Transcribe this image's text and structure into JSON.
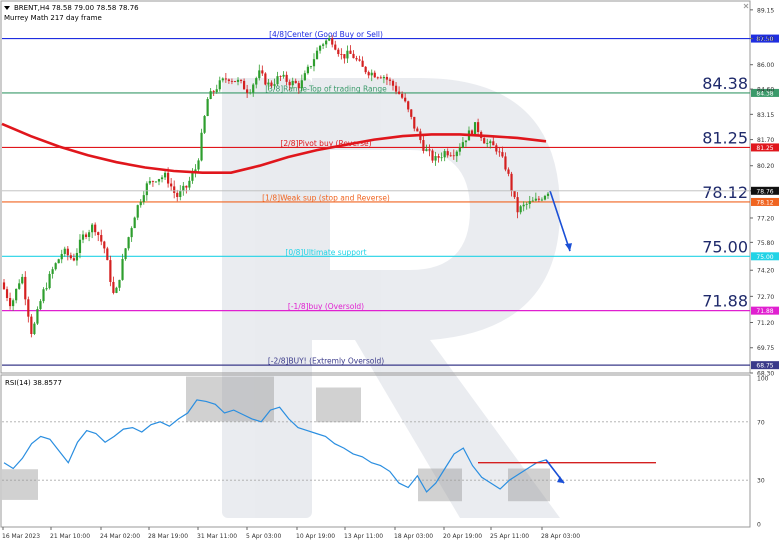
{
  "header": {
    "symbol_line": "BRENT,H4  78.58 79.00 78.58 78.76",
    "indicator_line": "Murrey Math 217 day frame"
  },
  "colors": {
    "bull": "#2e9e2e",
    "bear": "#d42020",
    "ma": "#e0161c",
    "rsi": "#2a8ee0",
    "arrow": "#1a4fd6",
    "level_4_8": "#1f2ee0",
    "level_3_8": "#3a9a6a",
    "level_2_8": "#e0161c",
    "level_1_8": "#f06420",
    "level_0_8": "#22d3e6",
    "level_m1_8": "#e020d0",
    "level_m2_8": "#3a3a8a"
  },
  "chart_data": [
    {
      "type": "line",
      "title": "BRENT,H4",
      "ylim": [
        68.3,
        89.6
      ],
      "y_ticks": [
        "89.15",
        "87.50",
        "86.00",
        "84.60",
        "83.15",
        "81.70",
        "80.20",
        "78.76",
        "77.20",
        "75.80",
        "74.20",
        "72.70",
        "71.20",
        "69.75",
        "68.30"
      ],
      "x_ticks": [
        "16 Mar 2023",
        "21 Mar 10:00",
        "24 Mar 02:00",
        "28 Mar 19:00",
        "31 Mar 11:00",
        "5 Apr 03:00",
        "10 Apr 19:00",
        "13 Apr 11:00",
        "18 Apr 03:00",
        "20 Apr 19:00",
        "25 Apr 11:00",
        "28 Apr 03:00"
      ],
      "levels": [
        {
          "key": "level_4_8",
          "value": 87.5,
          "label": "[4/8]Center (Good Buy or Sell)",
          "price_tag": "87.50",
          "big_value": ""
        },
        {
          "key": "level_3_8",
          "value": 84.38,
          "label": "[3/8]Range-Top of trading Range",
          "price_tag": "84.38",
          "big_value": "84.38"
        },
        {
          "key": "level_2_8",
          "value": 81.25,
          "label": "[2/8]Pivot buy (Reverse)",
          "price_tag": "81.25",
          "big_value": "81.25"
        },
        {
          "key": "level_1_8",
          "value": 78.12,
          "label": "[1/8]Weak sup (stop and Reverse)",
          "price_tag": "78.12",
          "big_value": "78.12"
        },
        {
          "key": "level_0_8",
          "value": 75.0,
          "label": "[0/8]Ultimate support",
          "price_tag": "75.00",
          "big_value": "75.00"
        },
        {
          "key": "level_m1_8",
          "value": 71.88,
          "label": "[-1/8]buy (Oversold)",
          "price_tag": "71.88",
          "big_value": "71.88"
        },
        {
          "key": "level_m2_8",
          "value": 68.75,
          "label": "[-2/8]BUY! (Extremly Oversold)",
          "price_tag": "68.75",
          "big_value": ""
        }
      ],
      "current_price": "78.76",
      "price_path": [
        73.5,
        72.2,
        74.0,
        70.5,
        72.8,
        74.2,
        75.3,
        74.8,
        76.2,
        76.8,
        75.5,
        72.5,
        75.3,
        77.5,
        79.0,
        79.5,
        79.6,
        78.4,
        79.0,
        80.2,
        84.0,
        84.8,
        85.3,
        85.0,
        84.5,
        85.5,
        84.8,
        85.3,
        85.0,
        84.8,
        86.0,
        87.2,
        87.5,
        86.5,
        86.6,
        85.8,
        85.5,
        85.4,
        84.8,
        84.0,
        82.5,
        81.2,
        80.5,
        81.0,
        81.0,
        81.8,
        82.5,
        81.5,
        81.2,
        80.0,
        77.6,
        78.0,
        78.2,
        78.76
      ],
      "ma_217": [
        82.6,
        81.9,
        81.3,
        80.8,
        80.4,
        80.1,
        79.9,
        79.8,
        79.8,
        80.2,
        80.7,
        81.1,
        81.4,
        81.7,
        81.9,
        82.0,
        82.0,
        81.9,
        81.8,
        81.6
      ],
      "forecast_target": 75.3
    },
    {
      "type": "line",
      "title": "RSI(14) 38.8577",
      "ylim": [
        0,
        100
      ],
      "y_ticks": [
        "100",
        "70",
        "30",
        "0"
      ],
      "series": [
        {
          "name": "RSI(14)",
          "values": [
            42,
            38,
            45,
            55,
            60,
            58,
            50,
            42,
            56,
            64,
            62,
            56,
            60,
            65,
            66,
            63,
            68,
            70,
            67,
            72,
            76,
            85,
            84,
            82,
            76,
            78,
            75,
            72,
            70,
            78,
            80,
            72,
            66,
            64,
            62,
            60,
            55,
            52,
            48,
            46,
            42,
            40,
            36,
            28,
            25,
            33,
            22,
            28,
            38,
            48,
            52,
            40,
            32,
            28,
            24,
            30,
            34,
            38,
            42,
            44
          ]
        }
      ],
      "resistance_value": 42,
      "forecast_target": 28
    }
  ]
}
